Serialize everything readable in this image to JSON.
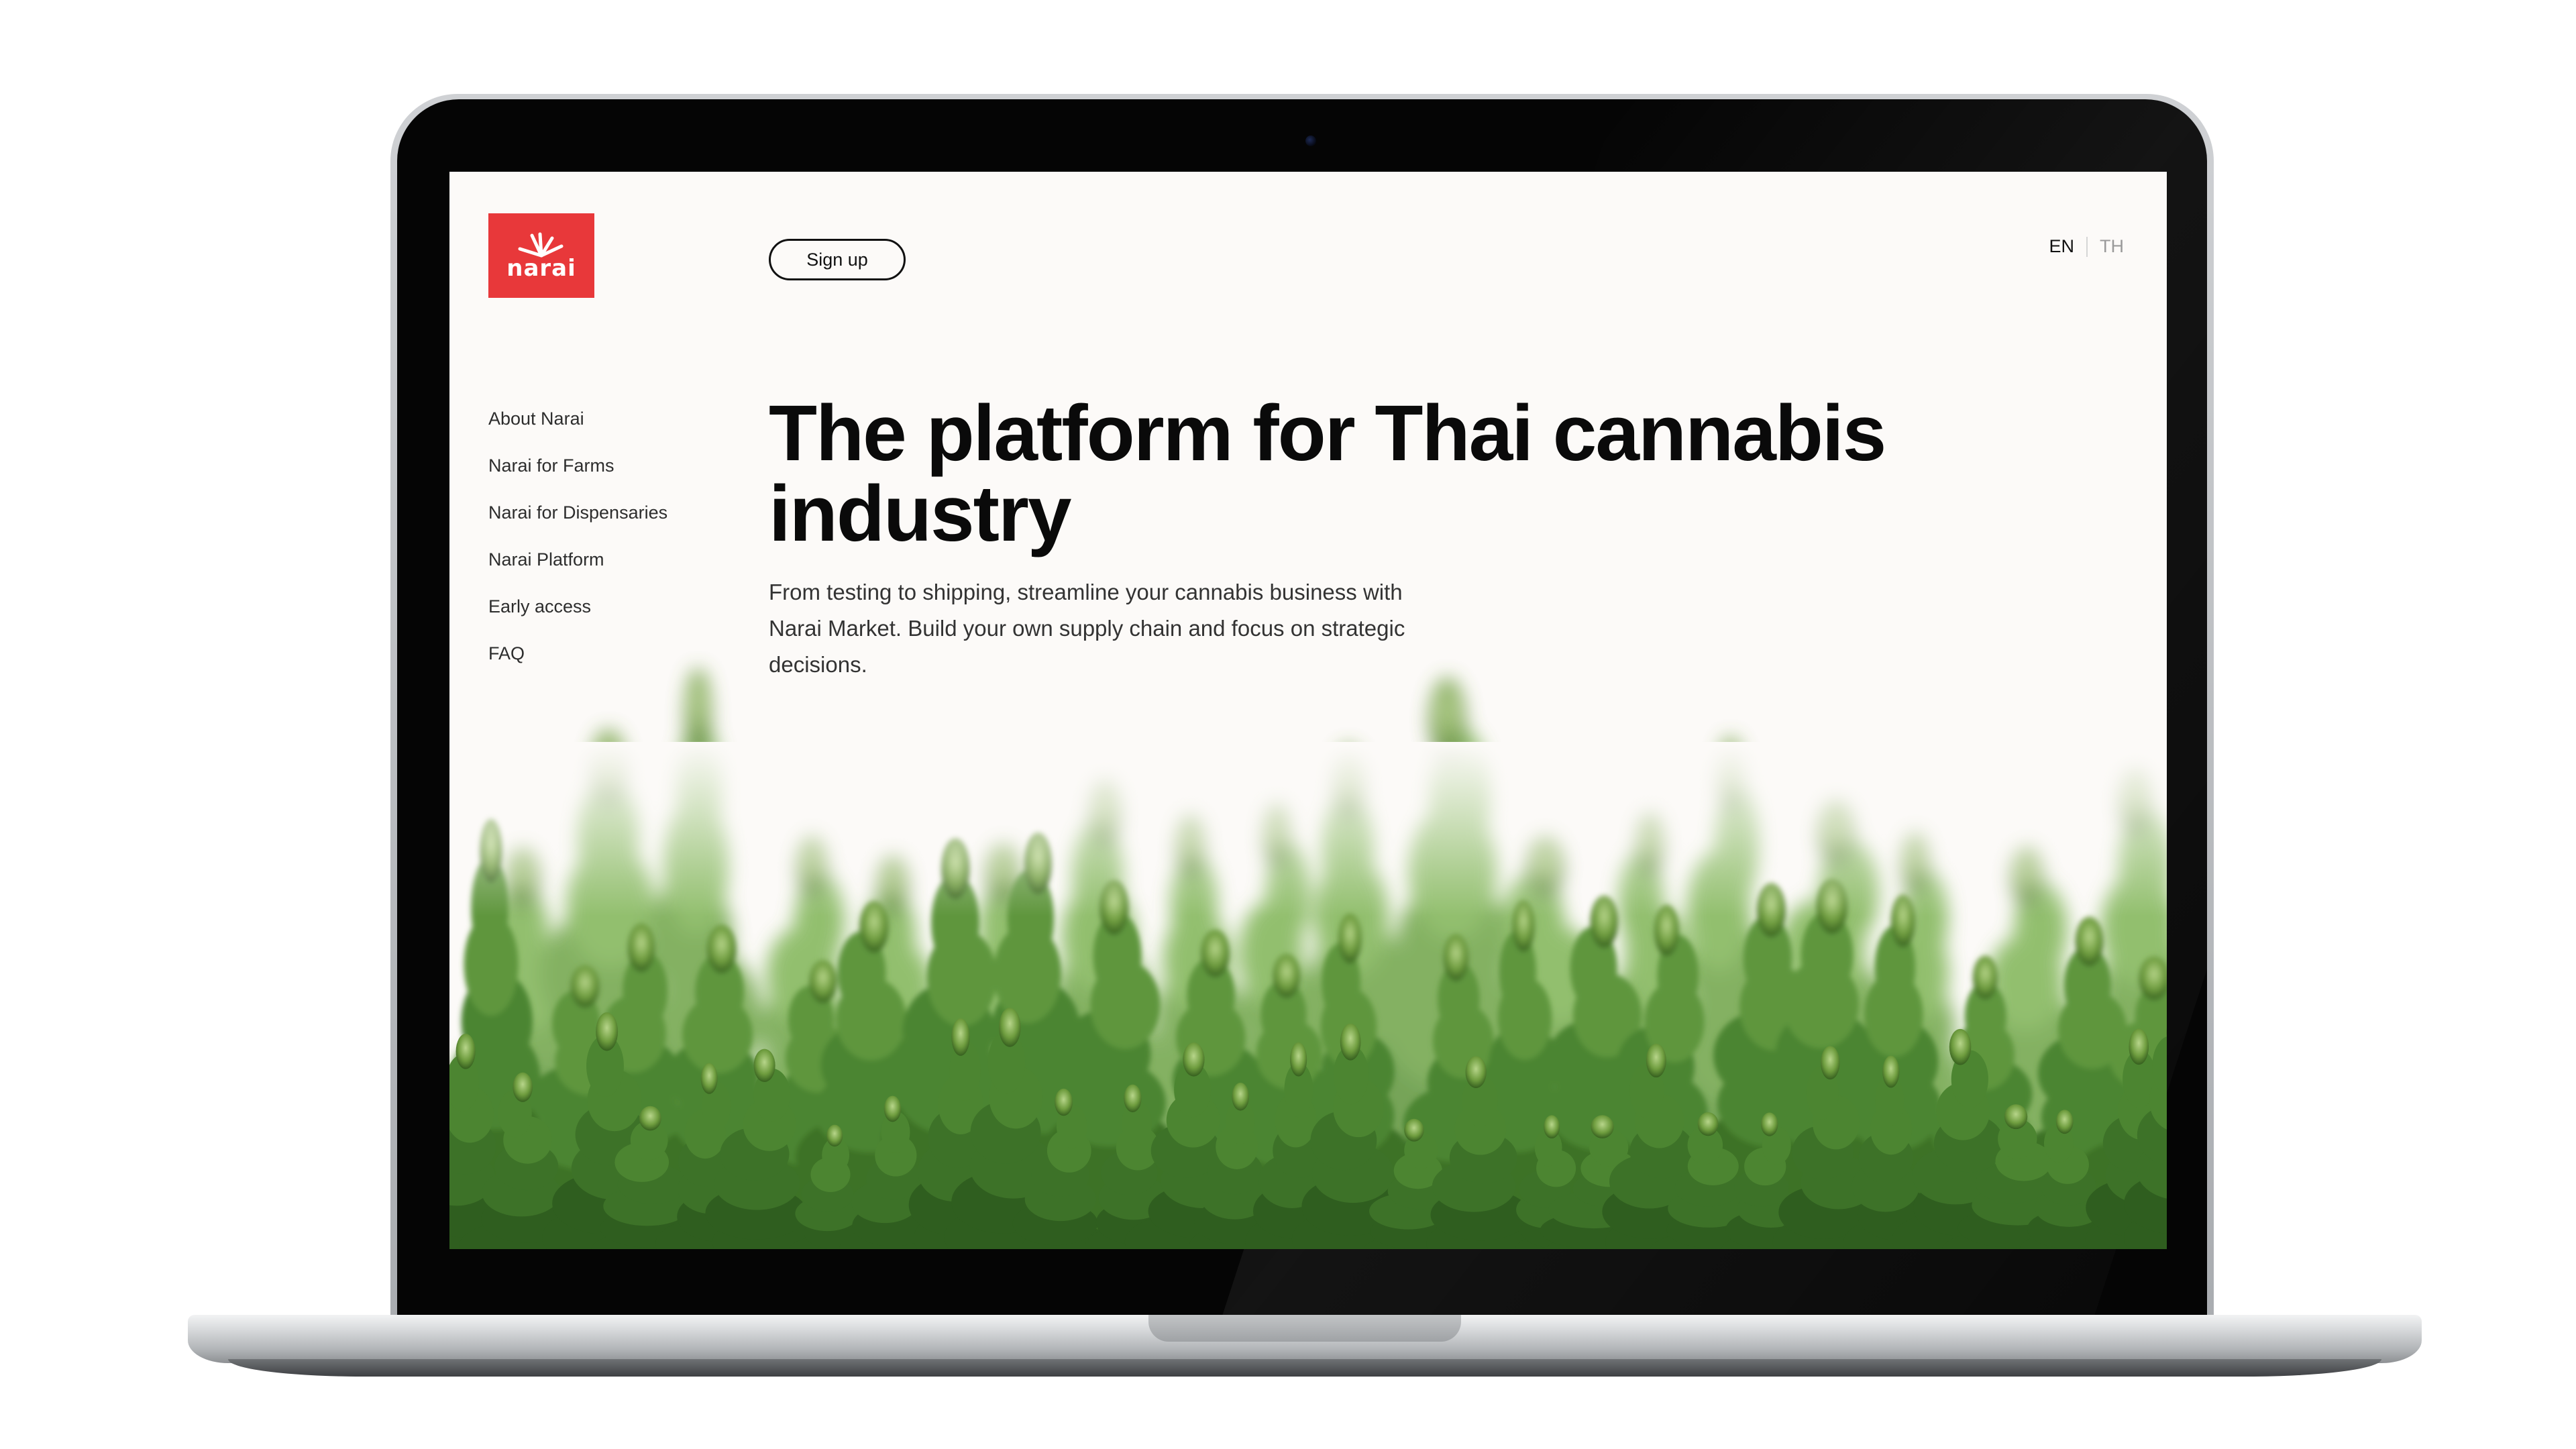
{
  "site": {
    "logo_text": "narai",
    "brand_color": "#e8383a",
    "signup_label": "Sign up",
    "lang": {
      "active": "EN",
      "inactive": "TH"
    }
  },
  "nav": {
    "items": [
      {
        "label": "About Narai"
      },
      {
        "label": "Narai for Farms"
      },
      {
        "label": "Narai for Dispensaries"
      },
      {
        "label": "Narai Platform"
      },
      {
        "label": "Early access"
      },
      {
        "label": "FAQ"
      }
    ]
  },
  "hero": {
    "headline": "The platform for Thai cannabis industry",
    "subtext": "From testing to shipping, streamline your cannabis business with Narai Market. Build your own supply chain and focus on strategic decisions."
  },
  "colors": {
    "page_bg": "#fcfaf8",
    "text": "#0a0a0a",
    "plant_dark": "#2f5e1f",
    "plant_light": "#8fbf5a"
  }
}
